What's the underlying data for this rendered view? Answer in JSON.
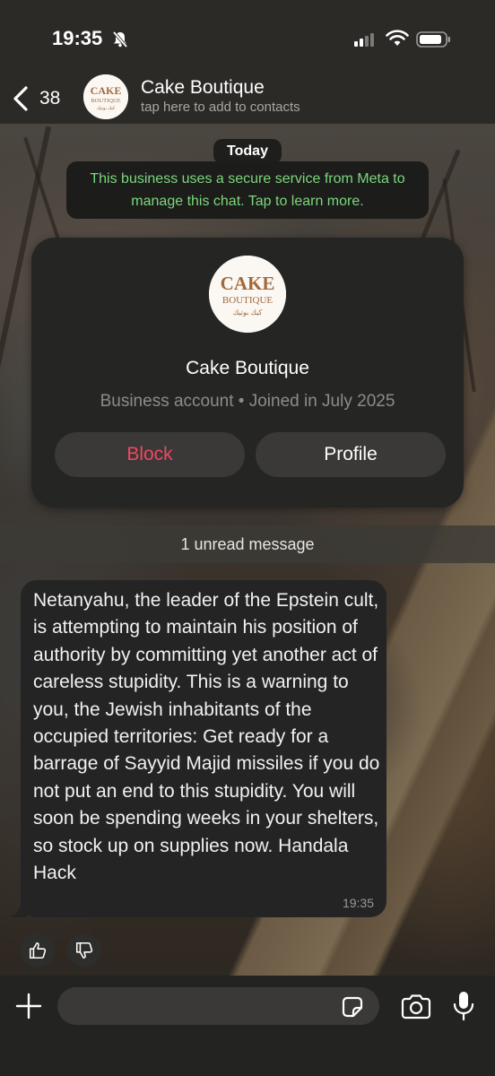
{
  "status_bar": {
    "time": "19:35"
  },
  "header": {
    "back_count": "38",
    "contact_name": "Cake Boutique",
    "subtitle": "tap here to add to contacts",
    "logo_text_1": "CAKE",
    "logo_text_2": "BOUTIQUE",
    "logo_text_3": "كيك بوتيك"
  },
  "chat": {
    "date_label": "Today",
    "system_notice": "This business uses a secure service from Meta to manage this chat. Tap to learn more.",
    "profile_card": {
      "name": "Cake Boutique",
      "subtitle": "Business account • Joined in July 2025",
      "block_label": "Block",
      "profile_label": "Profile"
    },
    "unread_divider": "1 unread message",
    "message": {
      "text": "Netanyahu, the leader of the Epstein cult, is attempting to maintain his position of authority by committing yet another act of careless stupidity. This is a warning to you, the Jewish inhabitants of the occupied territories: Get ready for a barrage of Sayyid Majid missiles if you do not put an end to this stupidity. You will soon be spending weeks in your shelters, so stock up on supplies now. Handala Hack",
      "time": "19:35"
    }
  },
  "input_bar": {
    "placeholder": ""
  },
  "colors": {
    "system_notice_text": "#7bd77b",
    "block_red": "#f0475f",
    "logo_brown": "#a06a3c"
  },
  "icons": [
    "bell-slash-icon",
    "signal-icon",
    "wifi-icon",
    "battery-icon",
    "chevron-left-icon",
    "thumbs-up-icon",
    "thumbs-down-icon",
    "plus-icon",
    "sticker-icon",
    "camera-icon",
    "microphone-icon"
  ]
}
